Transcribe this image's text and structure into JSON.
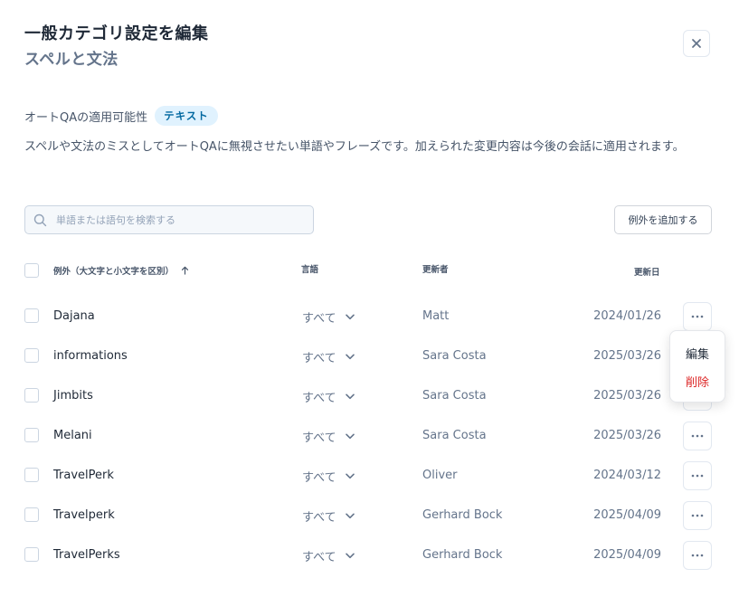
{
  "header": {
    "title": "一般カテゴリ設定を編集",
    "subtitle": "スペルと文法"
  },
  "availability": {
    "label": "オートQAの適用可能性",
    "tag": "テキスト"
  },
  "description": "スペルや文法のミスとしてオートQAに無視させたい単語やフレーズです。加えられた変更内容は今後の会話に適用されます。",
  "search": {
    "placeholder": "単語または語句を検索する",
    "value": ""
  },
  "add_button_label": "例外を追加する",
  "table": {
    "columns": {
      "exception": "例外（大文字と小文字を区別）",
      "language": "言語",
      "updated_by": "更新者",
      "updated_on": "更新日"
    },
    "sort": "ascending",
    "rows": [
      {
        "word": "Dajana",
        "language": "すべて",
        "updated_by": "Matt",
        "date": "2024/01/26"
      },
      {
        "word": "informations",
        "language": "すべて",
        "updated_by": "Sara Costa",
        "date": "2025/03/26"
      },
      {
        "word": "Jimbits",
        "language": "すべて",
        "updated_by": "Sara Costa",
        "date": "2025/03/26"
      },
      {
        "word": "Melani",
        "language": "すべて",
        "updated_by": "Sara Costa",
        "date": "2025/03/26"
      },
      {
        "word": "TravelPerk",
        "language": "すべて",
        "updated_by": "Oliver",
        "date": "2024/03/12"
      },
      {
        "word": "Travelperk",
        "language": "すべて",
        "updated_by": "Gerhard Bock",
        "date": "2025/04/09"
      },
      {
        "word": "TravelPerks",
        "language": "すべて",
        "updated_by": "Gerhard Bock",
        "date": "2025/04/09"
      }
    ]
  },
  "context_menu": {
    "edit": "編集",
    "delete": "削除"
  },
  "colors": {
    "tag_bg": "#e0f2fe",
    "tag_text": "#0369a1",
    "delete": "#dc2626"
  },
  "icons": [
    "close-icon",
    "search-icon",
    "sort-arrow-up-icon",
    "chevron-down-icon",
    "more-horizontal-icon"
  ]
}
